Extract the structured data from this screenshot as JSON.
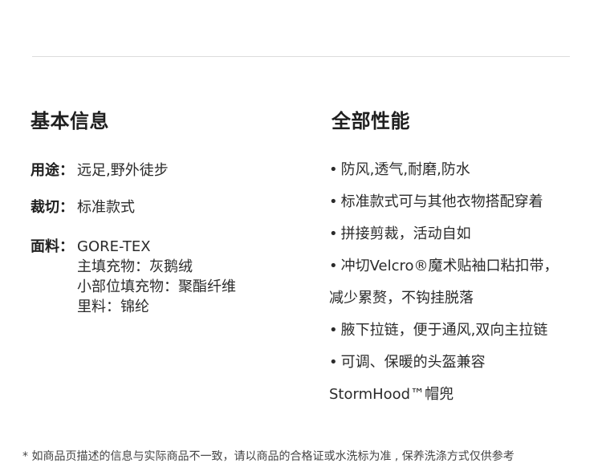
{
  "left": {
    "title": "基本信息",
    "specs": [
      {
        "label": "用途：",
        "values": [
          "远足,野外徒步"
        ]
      },
      {
        "label": "裁切：",
        "values": [
          "标准款式"
        ]
      },
      {
        "label": "面料：",
        "values": [
          "GORE-TEX",
          "主填充物：灰鹅绒",
          "小部位填充物：聚酯纤维",
          "里料：锦纶"
        ]
      }
    ]
  },
  "right": {
    "title": "全部性能",
    "bullet": "•",
    "lines": [
      {
        "bullet": true,
        "text": "防风,透气,耐磨,防水"
      },
      {
        "bullet": true,
        "text": "标准款式可与其他衣物搭配穿着"
      },
      {
        "bullet": true,
        "text": "拼接剪裁，活动自如"
      },
      {
        "bullet": true,
        "text": "冲切Velcro®魔术贴袖口粘扣带，"
      },
      {
        "bullet": false,
        "text": "减少累赘，不钩挂脱落"
      },
      {
        "bullet": true,
        "text": "腋下拉链，便于通风,双向主拉链"
      },
      {
        "bullet": true,
        "text": "可调、保暖的头盔兼容"
      },
      {
        "bullet": false,
        "text": "StormHood™帽兜"
      }
    ]
  },
  "footer": {
    "note": "* 如商品页描述的信息与实际商品不一致，请以商品的合格证或水洗标为准 , 保养洗涤方式仅供参考"
  }
}
